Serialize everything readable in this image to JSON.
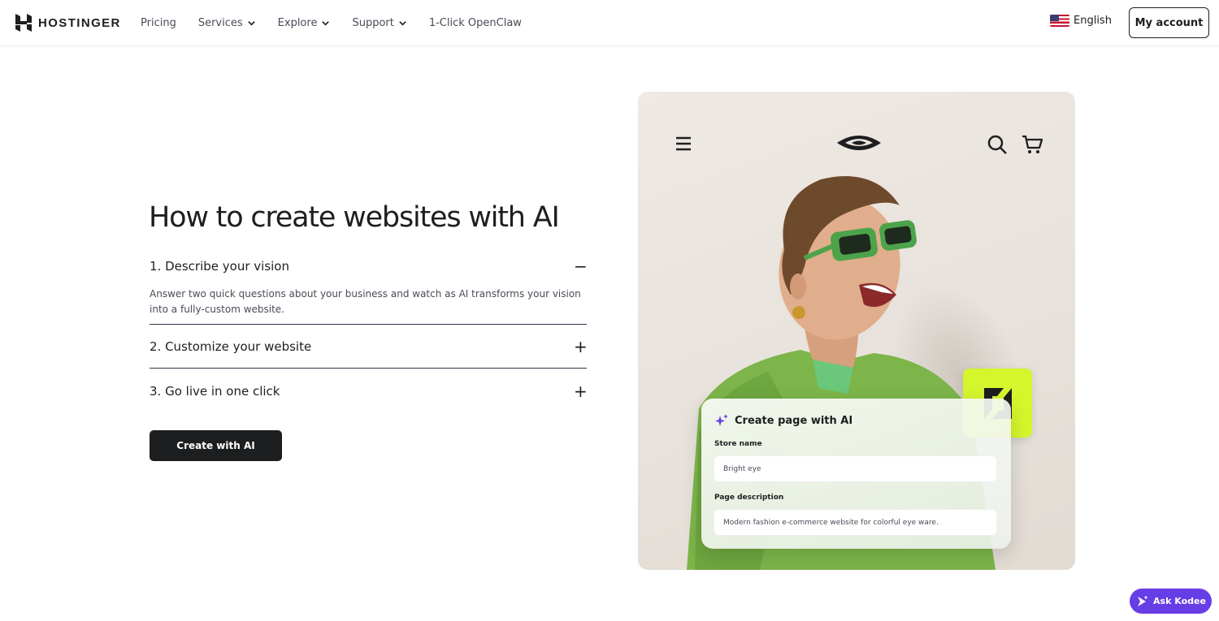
{
  "header": {
    "brand": "HOSTINGER",
    "nav": [
      {
        "label": "Pricing",
        "dropdown": false
      },
      {
        "label": "Services",
        "dropdown": true
      },
      {
        "label": "Explore",
        "dropdown": true
      },
      {
        "label": "Support",
        "dropdown": true
      },
      {
        "label": "1-Click OpenClaw",
        "dropdown": false
      }
    ],
    "language": "English",
    "account_label": "My account"
  },
  "main": {
    "heading": "How to create websites with AI",
    "steps": [
      {
        "title": "1. Describe your vision",
        "expanded": true,
        "toggle": "−",
        "description": "Answer two quick questions about your business and watch as AI transforms your vision into a fully-custom website."
      },
      {
        "title": "2. Customize your website",
        "expanded": false,
        "toggle": "+"
      },
      {
        "title": "3. Go live in one click",
        "expanded": false,
        "toggle": "+"
      }
    ],
    "cta_label": "Create with AI"
  },
  "preview": {
    "icons": [
      "menu-icon",
      "eye-logo-icon",
      "search-icon",
      "cart-icon"
    ],
    "form": {
      "title": "Create page with AI",
      "store_label": "Store name",
      "store_value": "Bright eye",
      "desc_label": "Page description",
      "desc_value": "Modern fashion e-commerce website for colorful eye ware."
    }
  },
  "assistant": {
    "label": "Ask Kodee"
  },
  "colors": {
    "accent": "#673de6",
    "lime": "#d5f52d",
    "text": "#1d1e20"
  }
}
